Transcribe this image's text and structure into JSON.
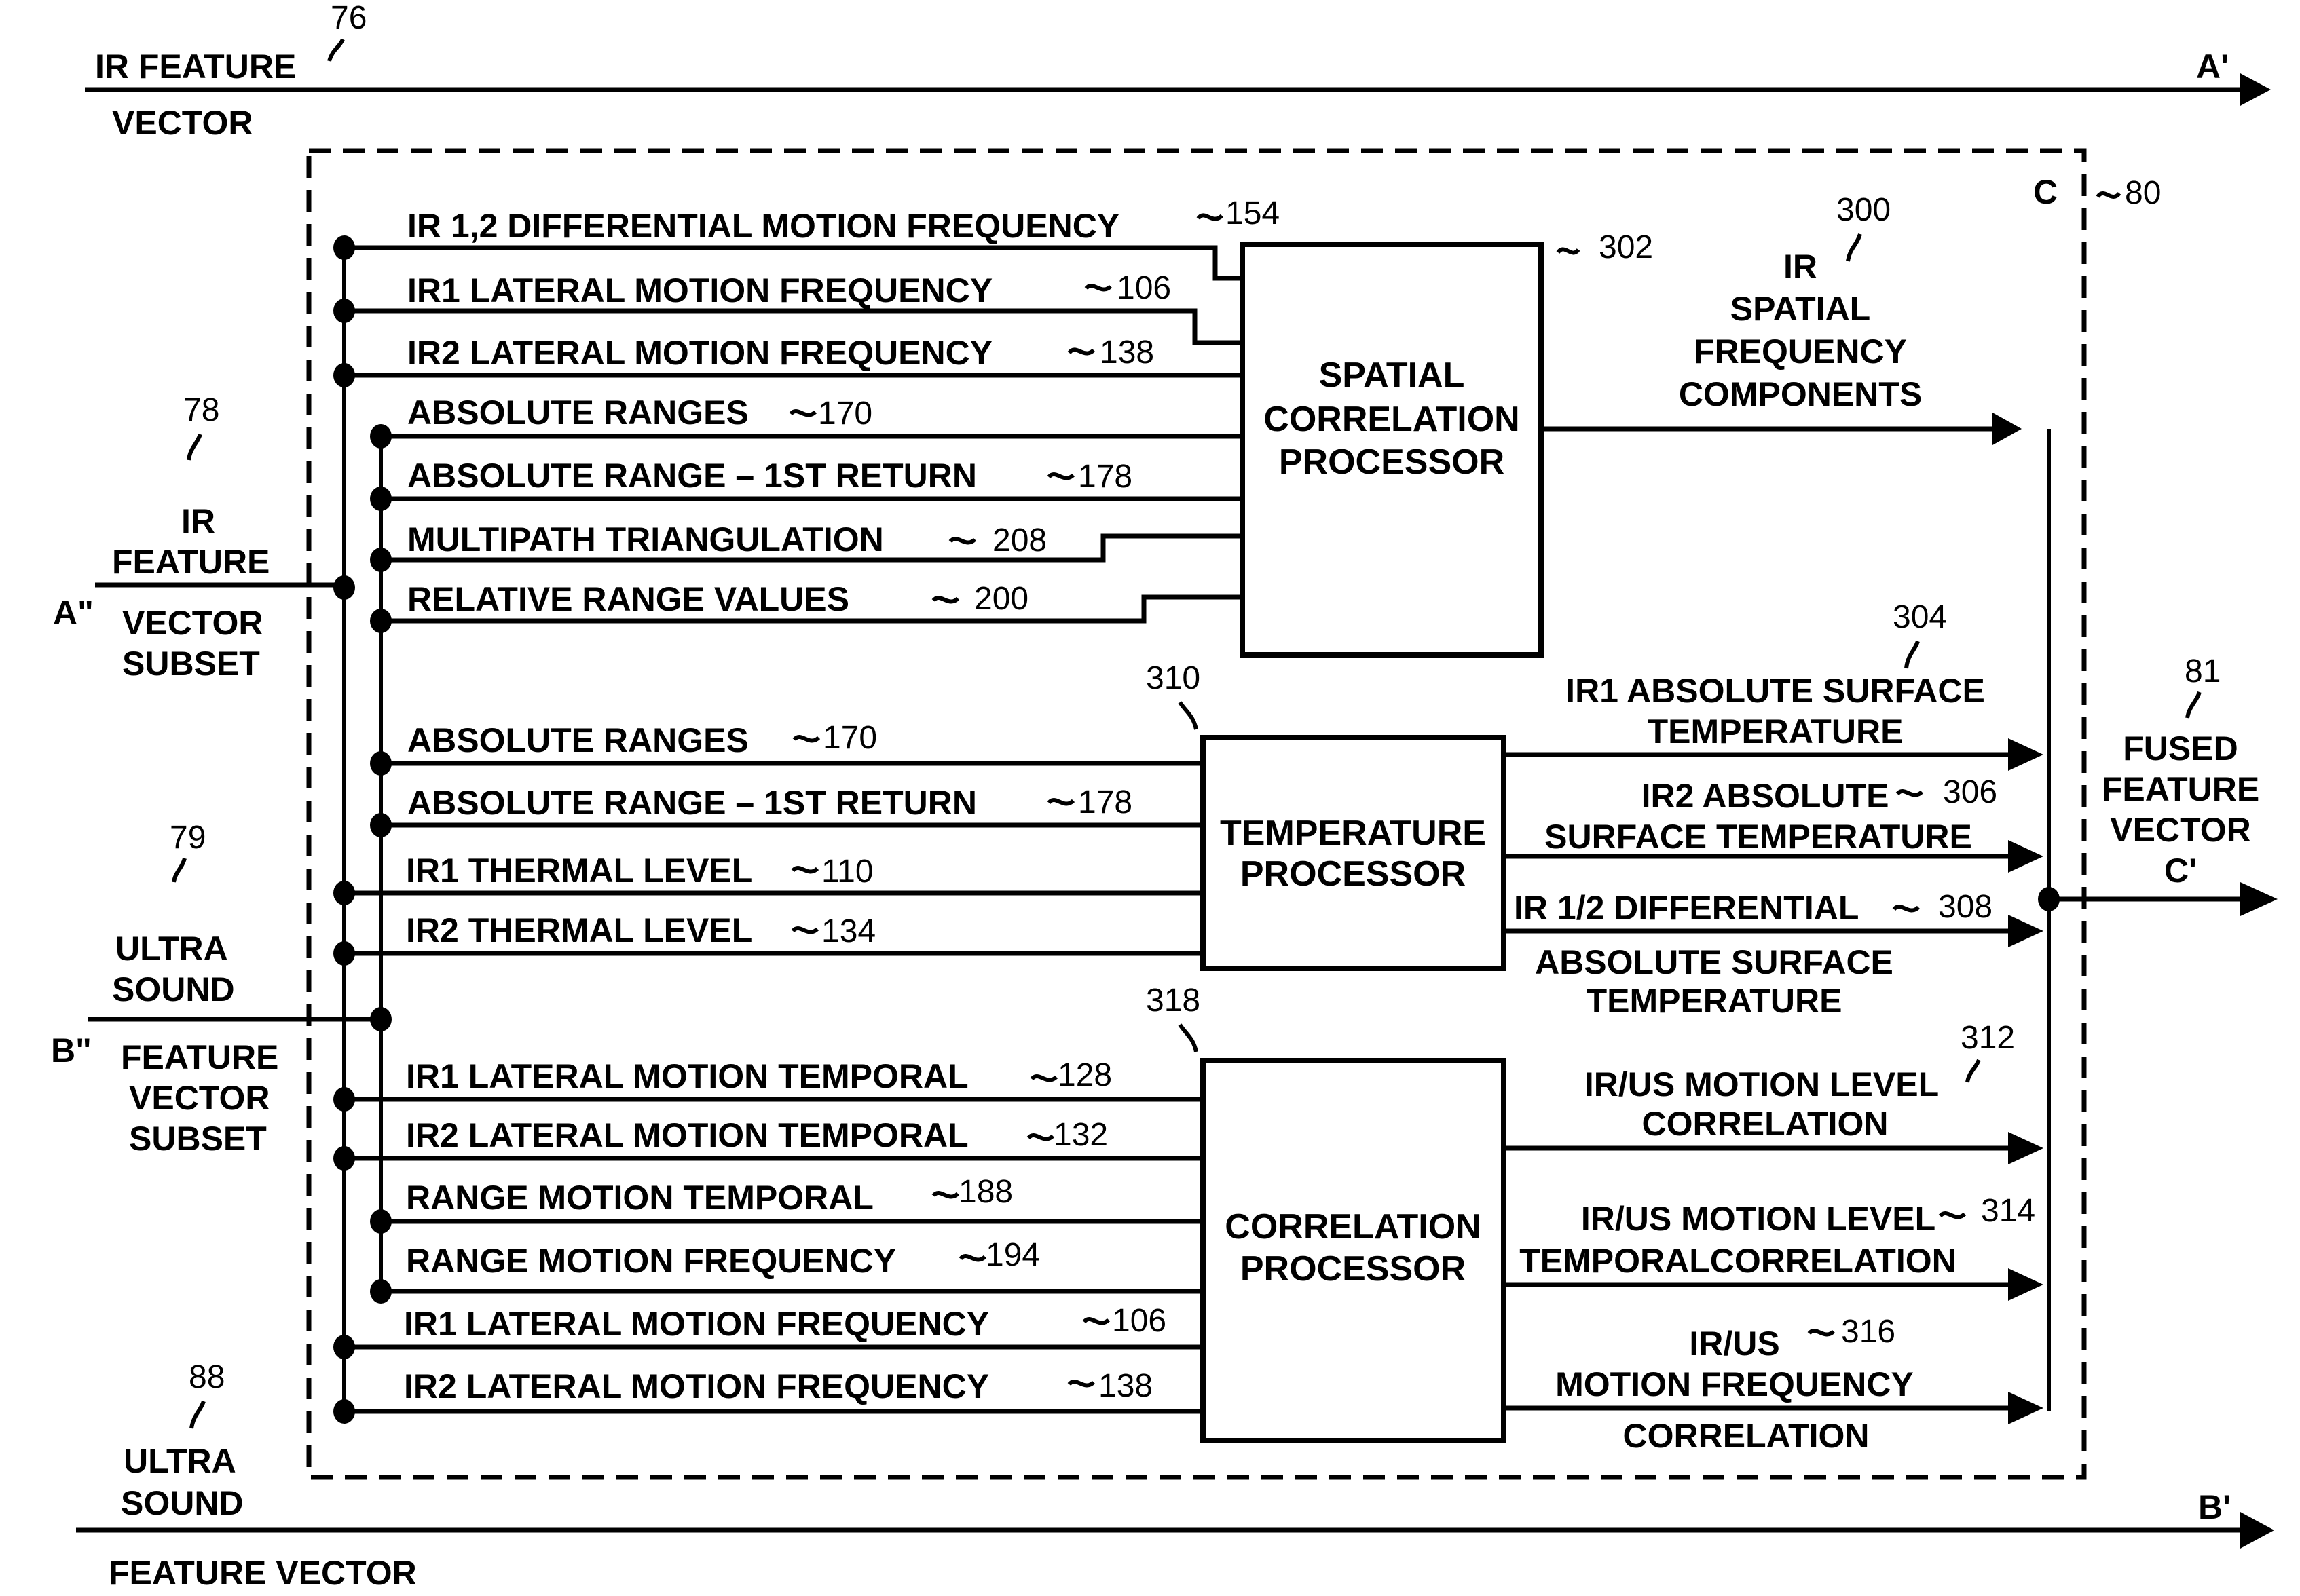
{
  "top_vector": {
    "label_line1": "IR FEATURE",
    "label_line2": "VECTOR",
    "ref": "76",
    "end_label": "A'"
  },
  "bottom_vector": {
    "label_line1": "ULTRA",
    "label_line2": "SOUND",
    "label_line3": "FEATURE VECTOR",
    "ref": "88",
    "end_label": "B'"
  },
  "fusion_module": {
    "ref": "80",
    "corner_label": "C"
  },
  "ir_subset": {
    "ref": "78",
    "lines": [
      "IR",
      "FEATURE",
      "VECTOR",
      "SUBSET"
    ],
    "port_label": "A\""
  },
  "us_subset": {
    "ref": "79",
    "lines": [
      "ULTRA",
      "SOUND",
      "FEATURE",
      "VECTOR",
      "SUBSET"
    ],
    "port_label": "B\""
  },
  "fused_output": {
    "ref": "81",
    "lines": [
      "FUSED",
      "FEATURE",
      "VECTOR"
    ],
    "port_label": "C'"
  },
  "processors": [
    {
      "id": "spatial",
      "ref": "302",
      "lines": [
        "SPATIAL",
        "CORRELATION",
        "PROCESSOR"
      ],
      "inputs": [
        {
          "label": "IR 1,2 DIFFERENTIAL MOTION FREQUENCY",
          "ref": "154"
        },
        {
          "label": "IR1 LATERAL  MOTION FREQUENCY",
          "ref": "106"
        },
        {
          "label": "IR2 LATERAL MOTION FREQUENCY",
          "ref": "138"
        },
        {
          "label": "ABSOLUTE RANGES",
          "ref": "170"
        },
        {
          "label": "ABSOLUTE RANGE – 1ST RETURN",
          "ref": "178"
        },
        {
          "label": "MULTIPATH TRIANGULATION",
          "ref": "208"
        },
        {
          "label": "RELATIVE RANGE VALUES",
          "ref": "200"
        }
      ],
      "outputs": [
        {
          "lines": [
            "IR",
            "SPATIAL",
            "FREQUENCY",
            "COMPONENTS"
          ],
          "ref": "300"
        }
      ]
    },
    {
      "id": "temperature",
      "ref": "310",
      "lines": [
        "TEMPERATURE",
        "PROCESSOR"
      ],
      "inputs": [
        {
          "label": "ABSOLUTE RANGES",
          "ref": "170"
        },
        {
          "label": "ABSOLUTE RANGE – 1ST RETURN",
          "ref": "178"
        },
        {
          "label": "IR1 THERMAL LEVEL",
          "ref": "110"
        },
        {
          "label": "IR2 THERMAL LEVEL",
          "ref": "134"
        }
      ],
      "outputs": [
        {
          "lines": [
            "IR1 ABSOLUTE SURFACE",
            "TEMPERATURE"
          ],
          "ref": "304"
        },
        {
          "lines": [
            "IR2 ABSOLUTE",
            "SURFACE TEMPERATURE"
          ],
          "ref": "306"
        },
        {
          "lines": [
            "IR 1/2 DIFFERENTIAL",
            "ABSOLUTE SURFACE",
            "TEMPERATURE"
          ],
          "ref": "308"
        }
      ]
    },
    {
      "id": "correlation",
      "ref": "318",
      "lines": [
        "CORRELATION",
        "PROCESSOR"
      ],
      "inputs": [
        {
          "label": "IR1 LATERAL  MOTION TEMPORAL",
          "ref": "128"
        },
        {
          "label": "IR2 LATERAL MOTION TEMPORAL",
          "ref": "132"
        },
        {
          "label": "RANGE MOTION TEMPORAL",
          "ref": "188"
        },
        {
          "label": "RANGE MOTION FREQUENCY",
          "ref": "194"
        },
        {
          "label": "IR1 LATERAL  MOTION FREQUENCY",
          "ref": "106"
        },
        {
          "label": "IR2 LATERAL  MOTION FREQUENCY",
          "ref": "138"
        }
      ],
      "outputs": [
        {
          "lines": [
            "IR/US MOTION LEVEL",
            "CORRELATION"
          ],
          "ref": "312"
        },
        {
          "lines": [
            "IR/US MOTION LEVEL",
            "TEMPORALCORRELATION"
          ],
          "ref": "314"
        },
        {
          "lines": [
            "IR/US",
            "MOTION FREQUENCY",
            "CORRELATION"
          ],
          "ref": "316"
        }
      ]
    }
  ]
}
